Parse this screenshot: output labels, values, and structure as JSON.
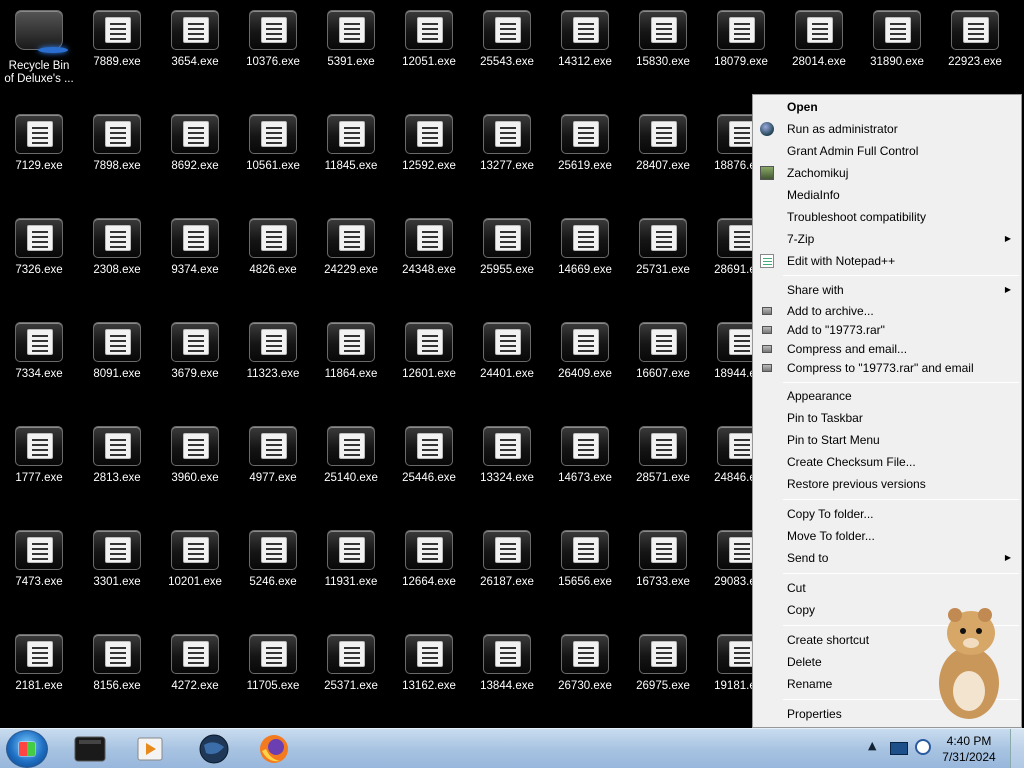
{
  "desktop": {
    "recycle_bin_label": "Recycle Bin",
    "overlay_label": "of Deluxe's ...",
    "columns": [
      [
        "7889.exe",
        "7898.exe",
        "2308.exe",
        "8091.exe",
        "2813.exe",
        "3301.exe",
        "8156.exe"
      ],
      [
        "3654.exe",
        "8692.exe",
        "9374.exe",
        "3679.exe",
        "3960.exe",
        "10201.exe",
        "4272.exe"
      ],
      [
        "10376.exe",
        "10561.exe",
        "4826.exe",
        "11323.exe",
        "4977.exe",
        "5246.exe",
        "11705.exe"
      ],
      [
        "5391.exe",
        "11845.exe",
        "24229.exe",
        "11864.exe",
        "25140.exe",
        "11931.exe",
        "25371.exe"
      ],
      [
        "12051.exe",
        "12592.exe",
        "24348.exe",
        "12601.exe",
        "25446.exe",
        "12664.exe",
        "13162.exe"
      ],
      [
        "25543.exe",
        "13277.exe",
        "25955.exe",
        "24401.exe",
        "13324.exe",
        "26187.exe",
        "13844.exe"
      ],
      [
        "14312.exe",
        "25619.exe",
        "14669.exe",
        "26409.exe",
        "14673.exe",
        "15656.exe",
        "26730.exe"
      ],
      [
        "15830.exe",
        "28407.exe",
        "25731.exe",
        "16607.exe",
        "28571.exe",
        "16733.exe",
        "26975.exe"
      ],
      [
        "18079.exe",
        "18876.exe",
        "28691.exe",
        "18944.exe",
        "24846.exe",
        "29083.exe",
        "19181.exe"
      ],
      [
        "28014.exe"
      ],
      [
        "31890.exe"
      ],
      [
        "22923.exe"
      ]
    ],
    "first_column": [
      "7129.exe",
      "7326.exe",
      "7334.exe",
      "1777.exe",
      "7473.exe",
      "2181.exe"
    ]
  },
  "context_menu": {
    "items": [
      {
        "label": "Open",
        "bold": true
      },
      {
        "label": "Run as administrator",
        "icon": "shield-globe-icon"
      },
      {
        "label": "Grant Admin Full Control"
      },
      {
        "label": "Zachomikuj",
        "icon": "hamster-avatar-icon"
      },
      {
        "label": "MediaInfo"
      },
      {
        "label": "Troubleshoot compatibility"
      },
      {
        "label": "7-Zip",
        "submenu": true
      },
      {
        "label": "Edit with Notepad++",
        "icon": "notepad-icon"
      },
      {
        "label": "Share with",
        "submenu": true
      },
      {
        "label": "Add to archive...",
        "icon": "rar-icon"
      },
      {
        "label": "Add to \"19773.rar\"",
        "icon": "rar-icon"
      },
      {
        "label": "Compress and email...",
        "icon": "rar-icon"
      },
      {
        "label": "Compress to \"19773.rar\" and email",
        "icon": "rar-icon"
      },
      {
        "label": "Appearance"
      },
      {
        "label": "Pin to Taskbar"
      },
      {
        "label": "Pin to Start Menu"
      },
      {
        "label": "Create Checksum File..."
      },
      {
        "label": "Restore previous versions"
      },
      {
        "label": "Copy To folder..."
      },
      {
        "label": "Move To folder..."
      },
      {
        "label": "Send to",
        "submenu": true
      },
      {
        "label": "Cut"
      },
      {
        "label": "Copy"
      },
      {
        "label": "Create shortcut"
      },
      {
        "label": "Delete"
      },
      {
        "label": "Rename"
      },
      {
        "label": "Properties"
      }
    ],
    "submenu_arrow": "▶"
  },
  "taskbar": {
    "apps": [
      "media-player-app-icon",
      "video-player-app-icon",
      "globe-app-icon",
      "firefox-app-icon"
    ],
    "tray_arrow": "▲",
    "clock_time": "4:40 PM",
    "clock_date": "7/31/2024"
  },
  "colors": {
    "taskbar": "#a9c4e2",
    "menu_bg": "#f0f0f0",
    "desktop_bg": "#000000"
  }
}
